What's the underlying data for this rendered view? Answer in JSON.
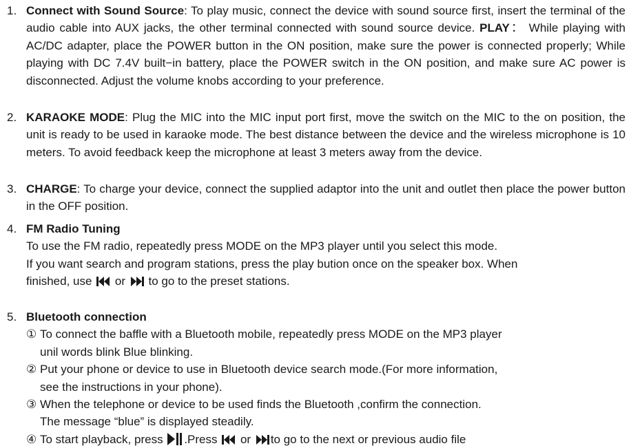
{
  "items": [
    {
      "num": "1.",
      "title": "Connect with Sound Source",
      "text": ": To play music, connect the device with sound source first, insert the terminal of the audio cable into AUX jacks, the other terminal connected with sound source device.",
      "play_title": "PLAY",
      "play_text": "： While playing with AC/DC adapter, place the POWER button in the ON position, make sure the power is connected properly; While playing with DC 7.4V built−in battery, place the POWER switch in the ON position, and make sure AC power is disconnected. Adjust the volume knobs according to your preference."
    },
    {
      "num": "2.",
      "title": "KARAOKE MODE",
      "text": ": Plug the MIC into the MIC input port first, move the switch on the MIC to the on position, the unit is ready to be used in karaoke mode. The best distance between the device and the wireless microphone is 10 meters. To avoid feedback keep the microphone at least 3 meters away from the device."
    },
    {
      "num": "3.",
      "title": "CHARGE",
      "text": ":  To charge your device, connect the supplied adaptor into the unit and outlet then place the power button in the OFF position."
    },
    {
      "num": "4.",
      "title": "FM Radio Tuning",
      "line1": "To use the FM radio, repeatedly press MODE on the MP3 player until you select this mode.",
      "line2": "If you want search and program stations, press the play bution once on the speaker box. When",
      "line3_a": "finished, use",
      "line3_or": "or",
      "line3_b": "to go to the preset stations."
    },
    {
      "num": "5.",
      "title": "Bluetooth connection",
      "s1_lead": "①",
      "s1_a": "To connect the baffle with a Bluetooth mobile, repeatedly press MODE on the MP3 player",
      "s1_b": "unil words blink Blue blinking.",
      "s2_lead": "②",
      "s2_a": "Put your phone or device to use in Bluetooth device search mode.(For more information,",
      "s2_b": "see the instructions in your phone).",
      "s3_lead": "③",
      "s3_a": "When the telephone or device to be used finds the Bluetooth ,confirm the connection.",
      "s3_b": "The message “blue” is displayed steadily.",
      "s4_lead": "④",
      "s4_a": "To start playback, press",
      "s4_b": ".Press",
      "s4_or": "or",
      "s4_c": "to go to the next or previous audio file"
    }
  ],
  "icons": {
    "prev": "previous-track-icon",
    "next": "next-track-icon",
    "play_pause": "play-pause-icon"
  }
}
